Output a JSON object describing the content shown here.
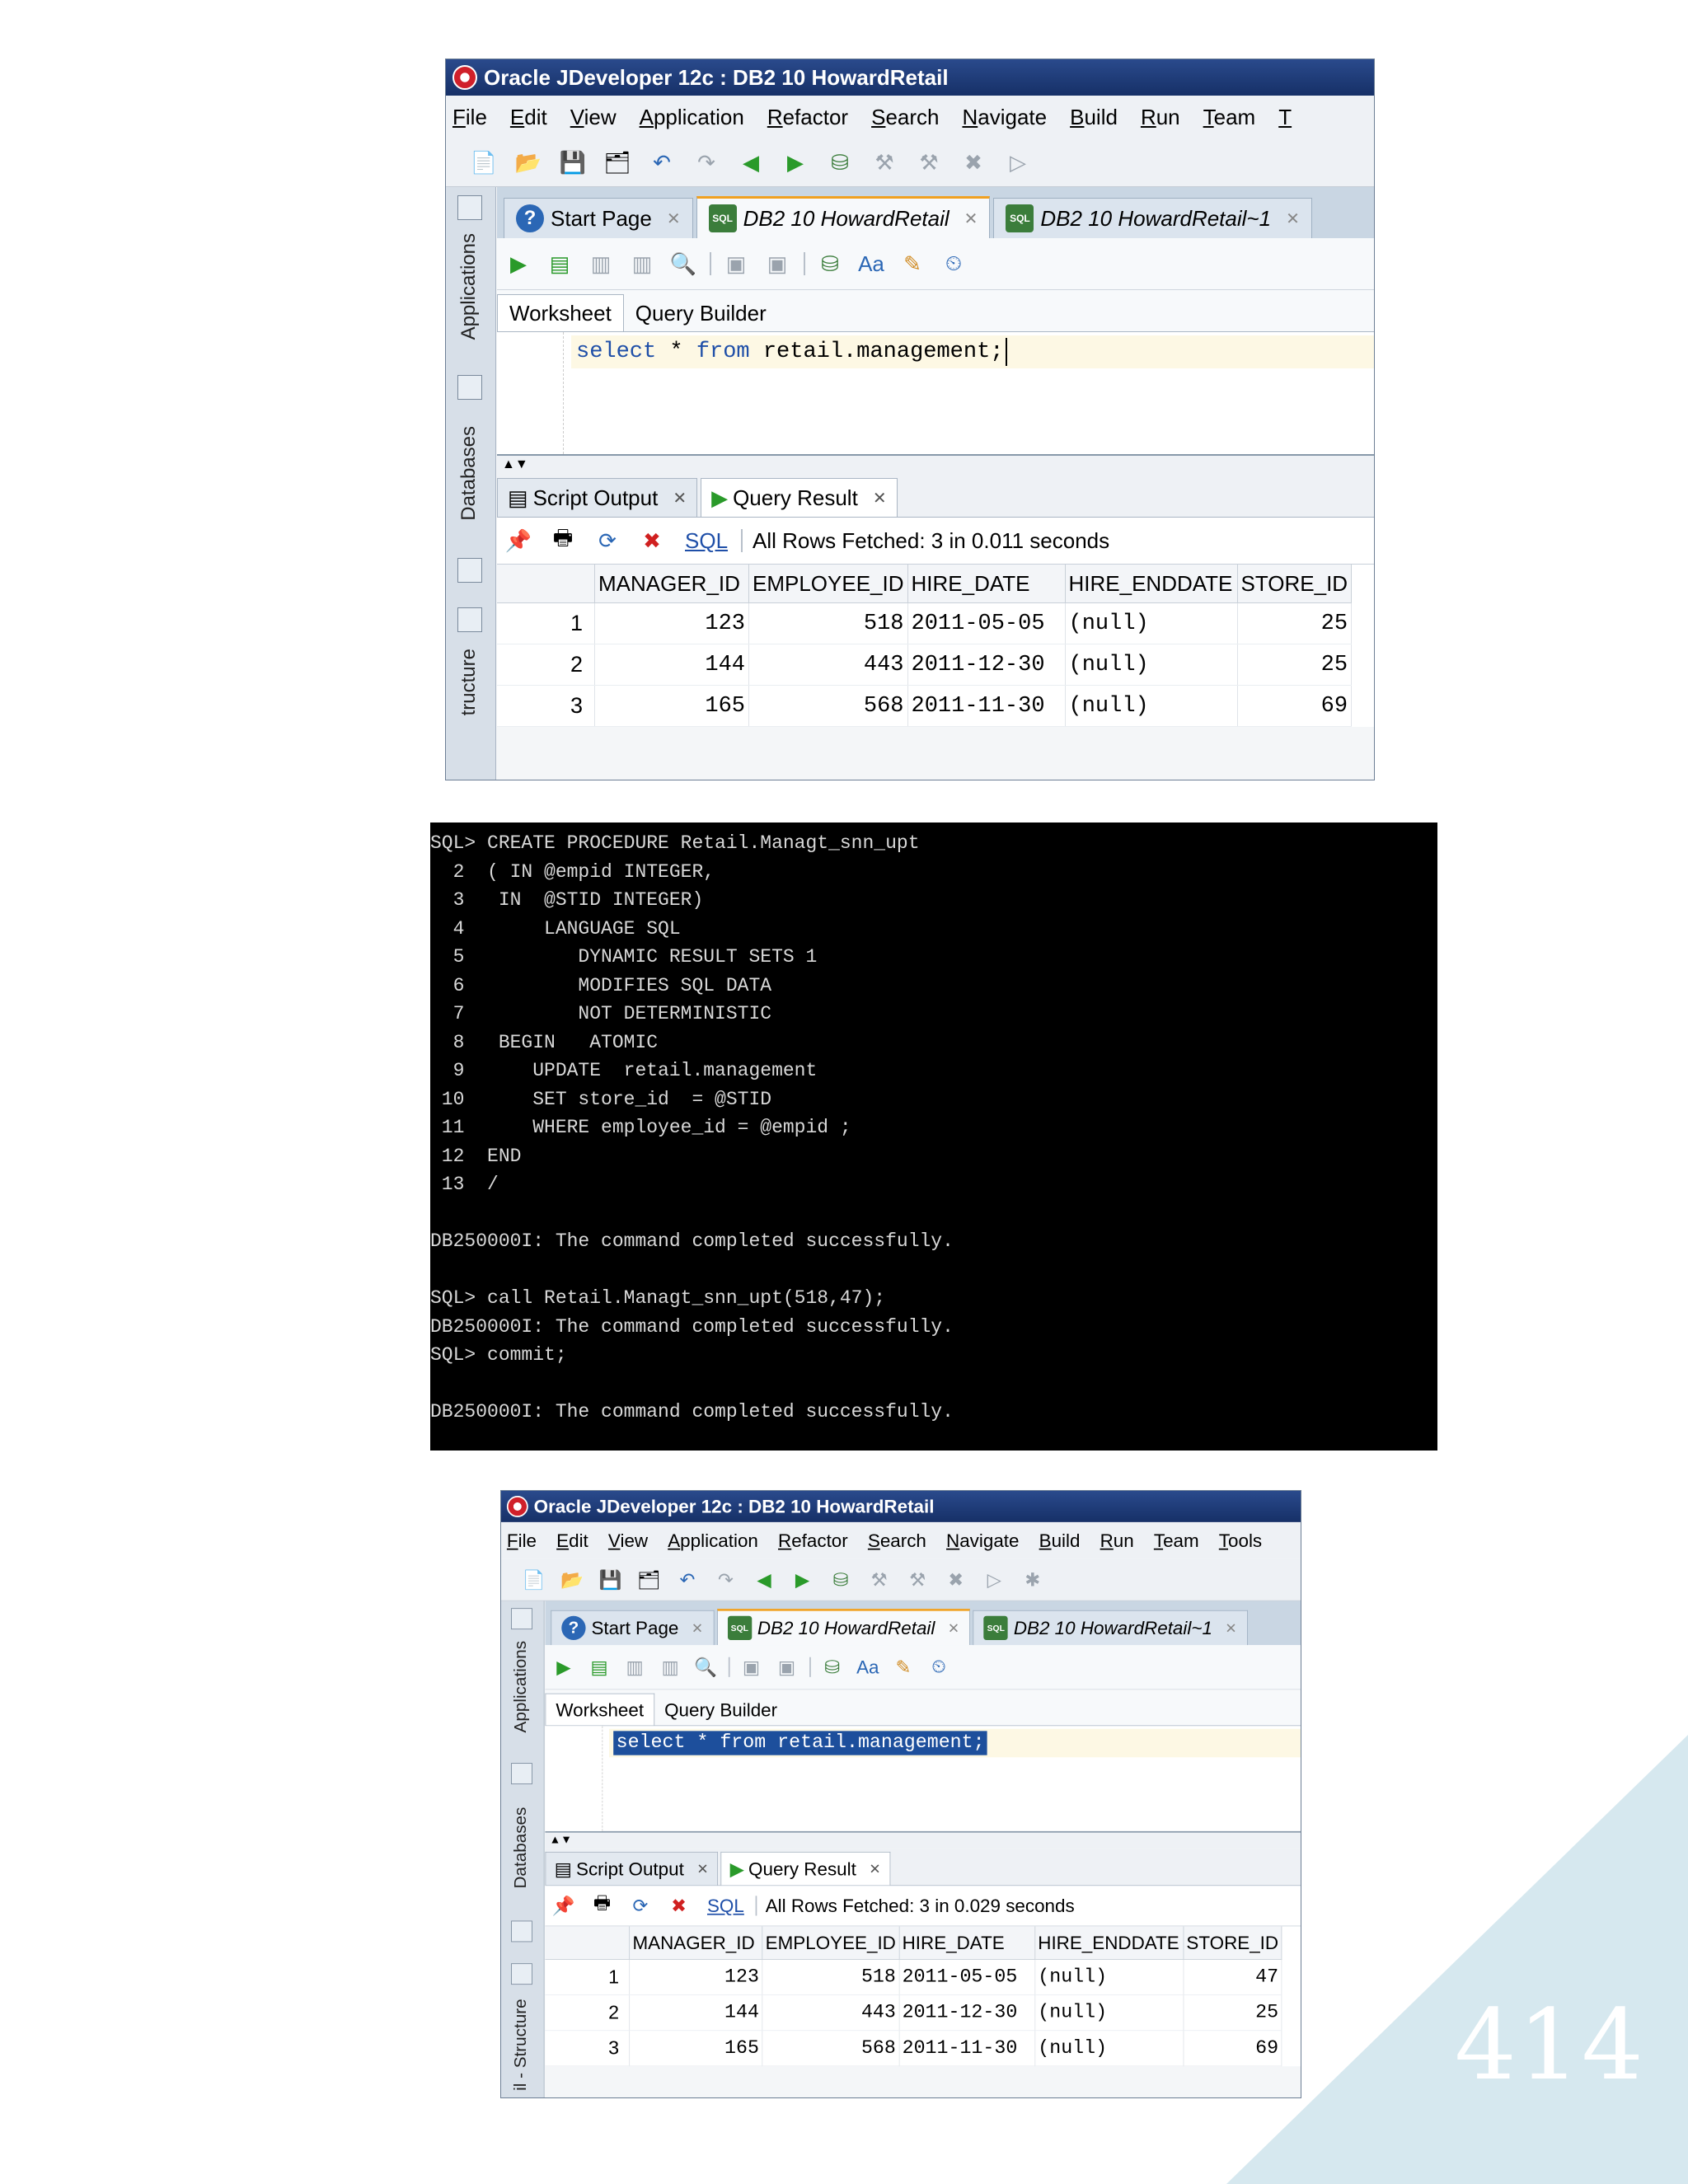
{
  "window1": {
    "title": "Oracle JDeveloper 12c : DB2 10 HowardRetail",
    "menu": [
      "File",
      "Edit",
      "View",
      "Application",
      "Refactor",
      "Search",
      "Navigate",
      "Build",
      "Run",
      "Team",
      "T"
    ],
    "sidebar": [
      "Applications",
      "Databases",
      "tructure"
    ],
    "tabs": [
      "Start Page",
      "DB2 10 HowardRetail",
      "DB2 10 HowardRetail~1"
    ],
    "subtabs": [
      "Worksheet",
      "Query Builder"
    ],
    "sql_keyword_select": "select",
    "sql_star": " * ",
    "sql_keyword_from": "from",
    "sql_rest": " retail.management;",
    "result_tabs": [
      "Script Output",
      "Query Result"
    ],
    "sql_link": "SQL",
    "status": "All Rows Fetched: 3 in 0.011 seconds",
    "columns": [
      "MANAGER_ID",
      "EMPLOYEE_ID",
      "HIRE_DATE",
      "HIRE_ENDDATE",
      "STORE_ID"
    ],
    "rows": [
      {
        "n": "1",
        "manager_id": "123",
        "employee_id": "518",
        "hire_date": "2011-05-05",
        "hire_enddate": "(null)",
        "store_id": "25"
      },
      {
        "n": "2",
        "manager_id": "144",
        "employee_id": "443",
        "hire_date": "2011-12-30",
        "hire_enddate": "(null)",
        "store_id": "25"
      },
      {
        "n": "3",
        "manager_id": "165",
        "employee_id": "568",
        "hire_date": "2011-11-30",
        "hire_enddate": "(null)",
        "store_id": "69"
      }
    ]
  },
  "terminal": {
    "lines": [
      "SQL> CREATE PROCEDURE Retail.Managt_snn_upt",
      "  2  ( IN @empid INTEGER,",
      "  3   IN  @STID INTEGER)",
      "  4       LANGUAGE SQL",
      "  5          DYNAMIC RESULT SETS 1",
      "  6          MODIFIES SQL DATA",
      "  7          NOT DETERMINISTIC",
      "  8   BEGIN   ATOMIC",
      "  9      UPDATE  retail.management",
      " 10      SET store_id  = @STID",
      " 11      WHERE employee_id = @empid ;",
      " 12  END",
      " 13  /",
      "",
      "DB250000I: The command completed successfully.",
      "",
      "SQL> call Retail.Managt_snn_upt(518,47);",
      "DB250000I: The command completed successfully.",
      "SQL> commit;",
      "",
      "DB250000I: The command completed successfully."
    ]
  },
  "window2": {
    "title": "Oracle JDeveloper 12c : DB2 10 HowardRetail",
    "menu": [
      "File",
      "Edit",
      "View",
      "Application",
      "Refactor",
      "Search",
      "Navigate",
      "Build",
      "Run",
      "Team",
      "Tools"
    ],
    "sidebar": [
      "Applications",
      "Databases",
      "il - Structure"
    ],
    "tabs": [
      "Start Page",
      "DB2 10 HowardRetail",
      "DB2 10 HowardRetail~1"
    ],
    "subtabs": [
      "Worksheet",
      "Query Builder"
    ],
    "sql_text": "select * from retail.management;",
    "result_tabs": [
      "Script Output",
      "Query Result"
    ],
    "sql_link": "SQL",
    "status": "All Rows Fetched: 3 in 0.029 seconds",
    "columns": [
      "MANAGER_ID",
      "EMPLOYEE_ID",
      "HIRE_DATE",
      "HIRE_ENDDATE",
      "STORE_ID"
    ],
    "rows": [
      {
        "n": "1",
        "manager_id": "123",
        "employee_id": "518",
        "hire_date": "2011-05-05",
        "hire_enddate": "(null)",
        "store_id": "47"
      },
      {
        "n": "2",
        "manager_id": "144",
        "employee_id": "443",
        "hire_date": "2011-12-30",
        "hire_enddate": "(null)",
        "store_id": "25"
      },
      {
        "n": "3",
        "manager_id": "165",
        "employee_id": "568",
        "hire_date": "2011-11-30",
        "hire_enddate": "(null)",
        "store_id": "69"
      }
    ]
  },
  "page_number": "414",
  "colors": {
    "corner": "#d6e8ef",
    "accent": "#1d4f9c",
    "titlebar": "#1f3d7a"
  }
}
